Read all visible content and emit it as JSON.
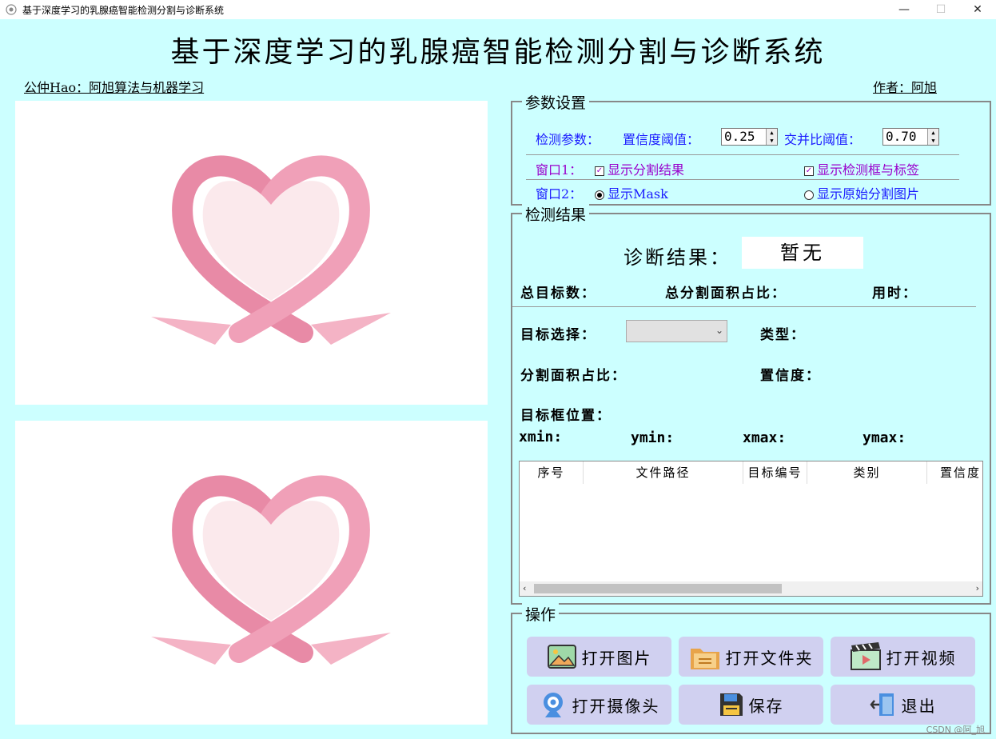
{
  "window": {
    "title": "基于深度学习的乳腺癌智能检测分割与诊断系统",
    "controls": {
      "minimize": "—",
      "maximize": "☐",
      "close": "✕"
    }
  },
  "header": {
    "title": "基于深度学习的乳腺癌智能检测分割与诊断系统",
    "left_link": "公仲Hao：阿旭算法与机器学习",
    "right_link": "作者：阿旭"
  },
  "params": {
    "group_title": "参数设置",
    "detect_label": "检测参数：",
    "conf_label": "置信度阈值：",
    "conf_value": "0.25",
    "iou_label": "交并比阈值：",
    "iou_value": "0.70",
    "window1_label": "窗口1：",
    "show_seg": "显示分割结果",
    "show_box": "显示检测框与标签",
    "window2_label": "窗口2：",
    "show_mask": "显示Mask",
    "show_orig": "显示原始分割图片"
  },
  "results": {
    "group_title": "检测结果",
    "diag_label": "诊断结果：",
    "diag_value": "暂无",
    "total_targets": "总目标数：",
    "total_area": "总分割面积占比：",
    "time_used": "用时：",
    "target_select": "目标选择：",
    "type_label": "类型：",
    "area_ratio": "分割面积占比：",
    "confidence": "置信度：",
    "box_pos": "目标框位置：",
    "xmin": "xmin:",
    "ymin": "ymin:",
    "xmax": "xmax:",
    "ymax": "ymax:",
    "table_headers": [
      "序号",
      "文件路径",
      "目标编号",
      "类别",
      "置信度"
    ]
  },
  "operations": {
    "group_title": "操作",
    "open_image": "打开图片",
    "open_folder": "打开文件夹",
    "open_video": "打开视频",
    "open_camera": "打开摄像头",
    "save": "保存",
    "exit": "退出"
  },
  "watermark": "CSDN @阿_旭"
}
